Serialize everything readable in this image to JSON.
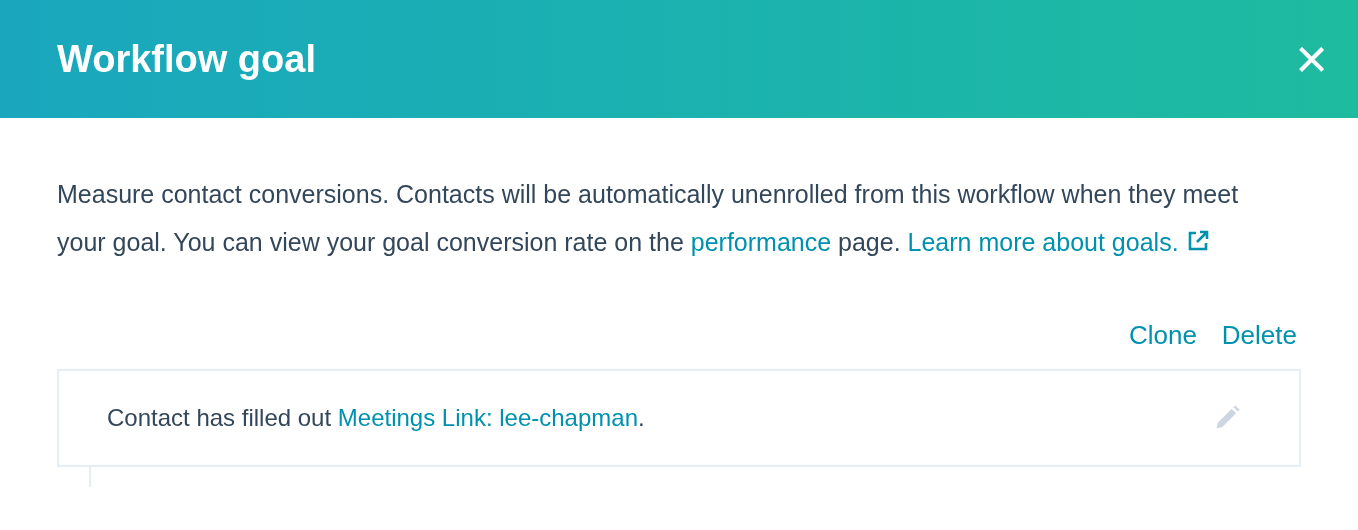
{
  "header": {
    "title": "Workflow goal",
    "close_icon": "×"
  },
  "description": [
    {
      "kind": "text",
      "text": "Measure contact conversions. Contacts will be automatically unenrolled from this workflow when they meet your goal. You can view your goal conversion rate on the "
    },
    {
      "kind": "link",
      "text": "performance"
    },
    {
      "kind": "text",
      "text": " page. "
    },
    {
      "kind": "external_link",
      "text": "Learn more about goals."
    }
  ],
  "actions": [
    "Clone",
    "Delete"
  ],
  "condition": [
    {
      "kind": "text",
      "text": "Contact has filled out "
    },
    {
      "kind": "link",
      "text": "Meetings Link: lee-chapman"
    },
    {
      "kind": "text",
      "text": "."
    }
  ]
}
